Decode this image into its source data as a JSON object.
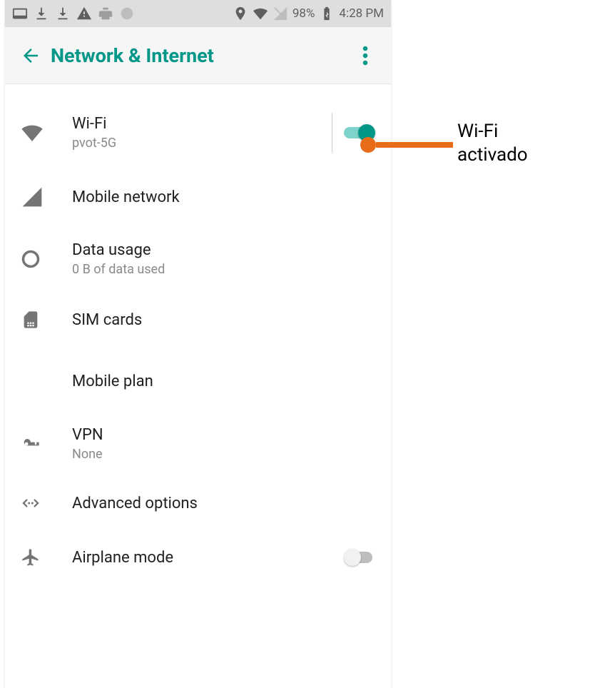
{
  "status_bar": {
    "battery_percent": "98%",
    "clock": "4:28 PM"
  },
  "app_bar": {
    "title": "Network & Internet"
  },
  "settings": {
    "wifi": {
      "label": "Wi-Fi",
      "sub": "pvot-5G",
      "on": true
    },
    "mobile_network": {
      "label": "Mobile network"
    },
    "data_usage": {
      "label": "Data usage",
      "sub": "0 B of data used"
    },
    "sim_cards": {
      "label": "SIM cards"
    },
    "mobile_plan": {
      "label": "Mobile plan"
    },
    "vpn": {
      "label": "VPN",
      "sub": "None"
    },
    "advanced": {
      "label": "Advanced options"
    },
    "airplane": {
      "label": "Airplane mode",
      "on": false
    }
  },
  "annotation": {
    "text": "Wi-Fi\nactivado"
  }
}
